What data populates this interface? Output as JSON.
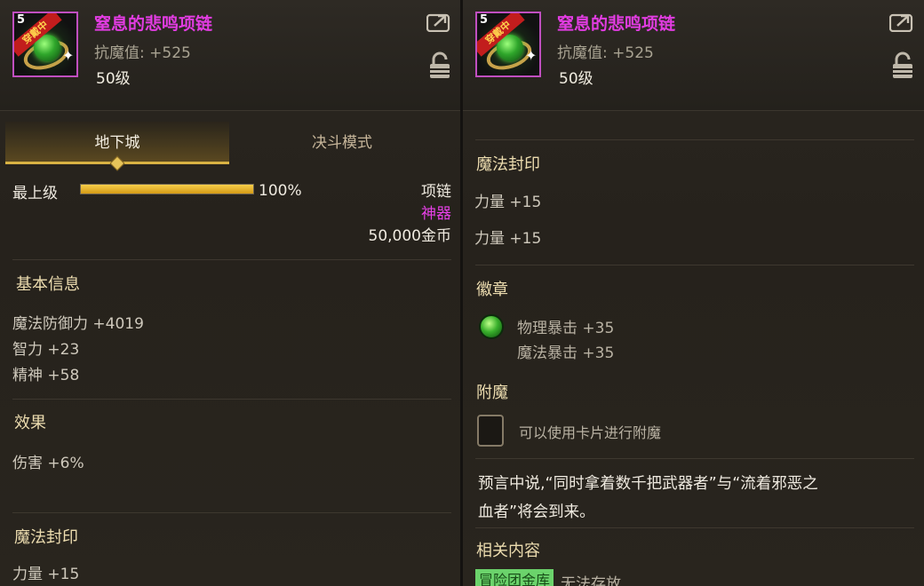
{
  "item": {
    "name": "窒息的悲鸣项链",
    "stat": "抗魔值: +525",
    "level": "50级",
    "icon_level": "5",
    "icon_badge": "穿戴中",
    "icons": [
      "necklace-icon",
      "share-icon",
      "lock-icon"
    ]
  },
  "tabs": [
    {
      "label": "地下城",
      "active": true
    },
    {
      "label": "决斗模式",
      "active": false
    }
  ],
  "left": {
    "grade_label": "最上级",
    "progress": 1.0,
    "progress_text": "100%",
    "type": "项链",
    "rarity": "神器",
    "price": "50,000金币",
    "basic_title": "基本信息",
    "basic_stats": [
      "魔法防御力 +4019",
      "智力 +23",
      "精神 +58"
    ],
    "effect_title": "效果",
    "effect_stats": [
      "伤害 +6%"
    ],
    "seal_title": "魔法封印",
    "seal_stats": [
      "力量 +15"
    ]
  },
  "right": {
    "seal_title": "魔法封印",
    "seal_stats": [
      "力量 +15",
      "力量 +15"
    ],
    "emblem_title": "徽章",
    "emblem_stats": [
      "物理暴击 +35",
      "魔法暴击 +35"
    ],
    "enchant_title": "附魔",
    "enchant_hint": "可以使用卡片进行附魔",
    "flavor_line1": "预言中说,“同时拿着数千把武器者”与“流着邪恶之",
    "flavor_line2": "血者”将会到来。",
    "related_title": "相关内容",
    "related_tag": "冒险团金库",
    "related_text": "无法存放"
  },
  "colors": {
    "accent_gold": "#d9b243",
    "name_purple": "#e23ce2",
    "rarity_purple": "#e640e6",
    "tag_green": "#6bd36b"
  }
}
